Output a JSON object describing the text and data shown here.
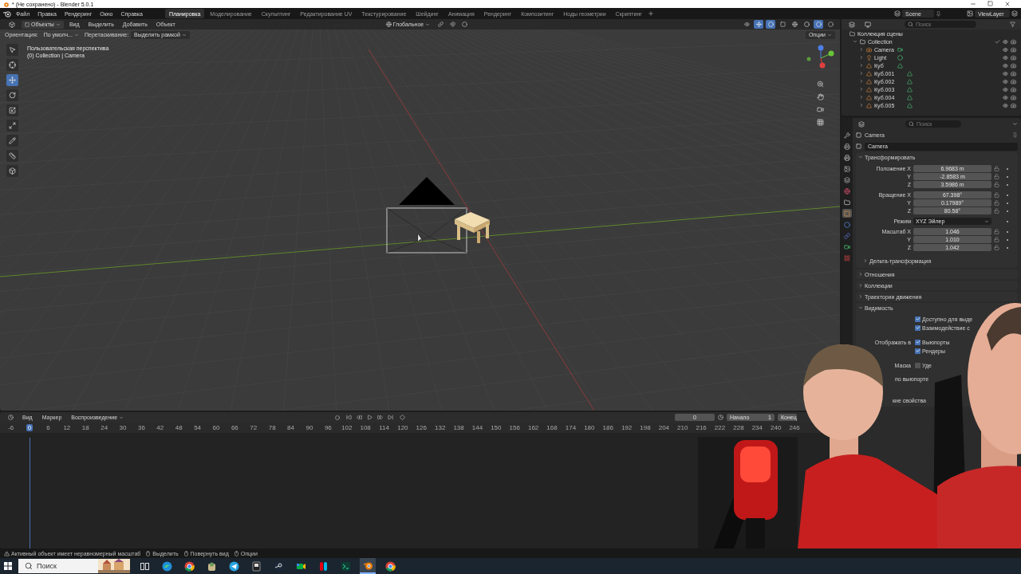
{
  "window": {
    "title": "* (Не сохранено) - Blender 5.0.1"
  },
  "menu": [
    "Файл",
    "Правка",
    "Рендеринг",
    "Окно",
    "Справка"
  ],
  "workspaces": [
    {
      "label": "Планировка",
      "selected": true
    },
    {
      "label": "Моделирование",
      "selected": false
    },
    {
      "label": "Скульптинг",
      "selected": false
    },
    {
      "label": "Редактирование UV",
      "selected": false
    },
    {
      "label": "Текстурирование",
      "selected": false
    },
    {
      "label": "Шейдинг",
      "selected": false
    },
    {
      "label": "Анимация",
      "selected": false
    },
    {
      "label": "Рендеринг",
      "selected": false
    },
    {
      "label": "Композитинг",
      "selected": false
    },
    {
      "label": "Ноды геометрии",
      "selected": false
    },
    {
      "label": "Скриптинг",
      "selected": false
    }
  ],
  "scene": "Scene",
  "view_layer": "ViewLayer",
  "viewport": {
    "mode": "Объекты",
    "menus": [
      "Вид",
      "Выделить",
      "Добавить",
      "Объект"
    ],
    "transform": "Глобальное",
    "options": "Опции",
    "orientation_label": "Ориентация:",
    "orientation": "По умолч...",
    "drag_label": "Перетаскивание:",
    "drag": "Выделить рамкой",
    "overlay": [
      "Пользовательская перспектива",
      "(0) Collection | Camera"
    ],
    "tools": [
      {
        "kind": "select",
        "selected": false
      },
      {
        "kind": "cursor",
        "selected": false
      },
      {
        "kind": "move",
        "selected": true
      },
      {
        "kind": "rotate",
        "selected": false
      },
      {
        "kind": "scale",
        "selected": false
      },
      {
        "kind": "transform",
        "selected": false
      },
      {
        "kind": "annotate",
        "selected": false
      },
      {
        "kind": "measure",
        "selected": false
      },
      {
        "kind": "add",
        "selected": false
      }
    ]
  },
  "outliner": {
    "search_placeholder": "Поиск",
    "root": "Коллекция сцены",
    "collection": {
      "name": "Collection",
      "expanded": true,
      "children": [
        {
          "name": "Camera",
          "kind": "camera",
          "expanded": false
        },
        {
          "name": "Light",
          "kind": "light",
          "expanded": false
        },
        {
          "name": "Куб",
          "kind": "mesh",
          "expanded": false
        },
        {
          "name": "Куб.001",
          "kind": "mesh",
          "expanded": false
        },
        {
          "name": "Куб.002",
          "kind": "mesh",
          "expanded": false
        },
        {
          "name": "Куб.003",
          "kind": "mesh",
          "expanded": false
        },
        {
          "name": "Куб.004",
          "kind": "mesh",
          "expanded": false
        },
        {
          "name": "Куб.005",
          "kind": "mesh",
          "expanded": false
        }
      ]
    }
  },
  "properties": {
    "search_placeholder": "Поиск",
    "breadcrumb": "Camera",
    "object_name": "Camera",
    "tabs": [
      {
        "kind": "tool",
        "selected": false
      },
      {
        "kind": "render",
        "selected": false
      },
      {
        "kind": "output",
        "selected": false
      },
      {
        "kind": "view_layer",
        "selected": false
      },
      {
        "kind": "scene",
        "selected": false
      },
      {
        "kind": "world",
        "selected": false
      },
      {
        "kind": "collection",
        "selected": false
      },
      {
        "kind": "object",
        "selected": true
      },
      {
        "kind": "physics",
        "selected": false
      },
      {
        "kind": "constraints",
        "selected": false
      },
      {
        "kind": "data",
        "selected": false
      },
      {
        "kind": "texture",
        "selected": false
      }
    ],
    "transform": {
      "title": "Трансформировать",
      "expanded": true,
      "groups": [
        {
          "kind": "fields",
          "rows": [
            {
              "label": "Положение X",
              "value": "6.9683 m"
            },
            {
              "label": "Y",
              "value": "-2.8583 m"
            },
            {
              "label": "Z",
              "value": "3.5986 m"
            }
          ]
        },
        {
          "kind": "fields",
          "rows": [
            {
              "label": "Вращение X",
              "value": "67.398°"
            },
            {
              "label": "Y",
              "value": "0.17989°"
            },
            {
              "label": "Z",
              "value": "80.58°"
            }
          ]
        },
        {
          "kind": "dropdown",
          "label": "Режим",
          "value": "XYZ Эйлер"
        },
        {
          "kind": "fields",
          "rows": [
            {
              "label": "Масштаб X",
              "value": "1.046"
            },
            {
              "label": "Y",
              "value": "1.010"
            },
            {
              "label": "Z",
              "value": "1.042"
            }
          ]
        }
      ],
      "subpanel": {
        "title": "Дельта-трансформация",
        "expanded": false
      }
    },
    "panels": [
      {
        "title": "Отношения",
        "expanded": false
      },
      {
        "title": "Коллекции",
        "expanded": false
      },
      {
        "title": "Траектории движения",
        "expanded": false
      },
      {
        "title": "Видимость",
        "expanded": true
      }
    ],
    "visibility": [
      {
        "kind": "check",
        "text": "Доступно для выде",
        "checked": true
      },
      {
        "kind": "check",
        "text": "Взаимодействие с",
        "checked": true
      },
      {
        "kind": "labeled_check",
        "label": "Отображать в",
        "text": "Выюпорты",
        "checked": true
      },
      {
        "kind": "check",
        "text": "Рендеры",
        "checked": true
      },
      {
        "kind": "labeled_check",
        "label": "Маска",
        "text": "Уде",
        "checked": false
      },
      {
        "kind": "note",
        "text": "по выюпорте"
      },
      {
        "kind": "note",
        "text": "кие свойства"
      }
    ]
  },
  "timeline": {
    "menus": [
      "Вид",
      "Маркер",
      "Воспроизведение"
    ],
    "current_frame": "0",
    "start_label": "Начало",
    "start": "1",
    "end_label": "Конец",
    "ticks": [
      {
        "label": "-6",
        "current": false
      },
      {
        "label": "0",
        "current": true
      },
      {
        "label": "6",
        "current": false
      },
      {
        "label": "12",
        "current": false
      },
      {
        "label": "18",
        "current": false
      },
      {
        "label": "24",
        "current": false
      },
      {
        "label": "30",
        "current": false
      },
      {
        "label": "36",
        "current": false
      },
      {
        "label": "42",
        "current": false
      },
      {
        "label": "48",
        "current": false
      },
      {
        "label": "54",
        "current": false
      },
      {
        "label": "60",
        "current": false
      },
      {
        "label": "66",
        "current": false
      },
      {
        "label": "72",
        "current": false
      },
      {
        "label": "78",
        "current": false
      },
      {
        "label": "84",
        "current": false
      },
      {
        "label": "90",
        "current": false
      },
      {
        "label": "96",
        "current": false
      },
      {
        "label": "102",
        "current": false
      },
      {
        "label": "108",
        "current": false
      },
      {
        "label": "114",
        "current": false
      },
      {
        "label": "120",
        "current": false
      },
      {
        "label": "126",
        "current": false
      },
      {
        "label": "132",
        "current": false
      },
      {
        "label": "138",
        "current": false
      },
      {
        "label": "144",
        "current": false
      },
      {
        "label": "150",
        "current": false
      },
      {
        "label": "156",
        "current": false
      },
      {
        "label": "162",
        "current": false
      },
      {
        "label": "168",
        "current": false
      },
      {
        "label": "174",
        "current": false
      },
      {
        "label": "180",
        "current": false
      },
      {
        "label": "186",
        "current": false
      },
      {
        "label": "192",
        "current": false
      },
      {
        "label": "198",
        "current": false
      },
      {
        "label": "204",
        "current": false
      },
      {
        "label": "210",
        "current": false
      },
      {
        "label": "216",
        "current": false
      },
      {
        "label": "222",
        "current": false
      },
      {
        "label": "228",
        "current": false
      },
      {
        "label": "234",
        "current": false
      },
      {
        "label": "240",
        "current": false
      },
      {
        "label": "246",
        "current": false
      }
    ]
  },
  "status": [
    {
      "kind": "warning",
      "text": "Активный объект имеет неравномерный масштаб"
    },
    {
      "kind": "mouse",
      "text": "Выделить"
    },
    {
      "kind": "mouse",
      "text": "Повернуть вид"
    },
    {
      "kind": "mouse",
      "text": "Опции"
    }
  ],
  "taskbar": {
    "search_placeholder": "Поиск",
    "apps": [
      {
        "kind": "taskview",
        "active": false
      },
      {
        "kind": "edge",
        "active": false
      },
      {
        "kind": "chrome",
        "active": false
      },
      {
        "kind": "app",
        "active": false
      },
      {
        "kind": "telegram",
        "active": false
      },
      {
        "kind": "epic",
        "active": false
      },
      {
        "kind": "steam",
        "active": false
      },
      {
        "kind": "meet",
        "active": false
      },
      {
        "kind": "switch",
        "active": false
      },
      {
        "kind": "terminal",
        "active": false
      },
      {
        "kind": "blender",
        "active": true
      },
      {
        "kind": "chrome",
        "active": false
      }
    ]
  }
}
